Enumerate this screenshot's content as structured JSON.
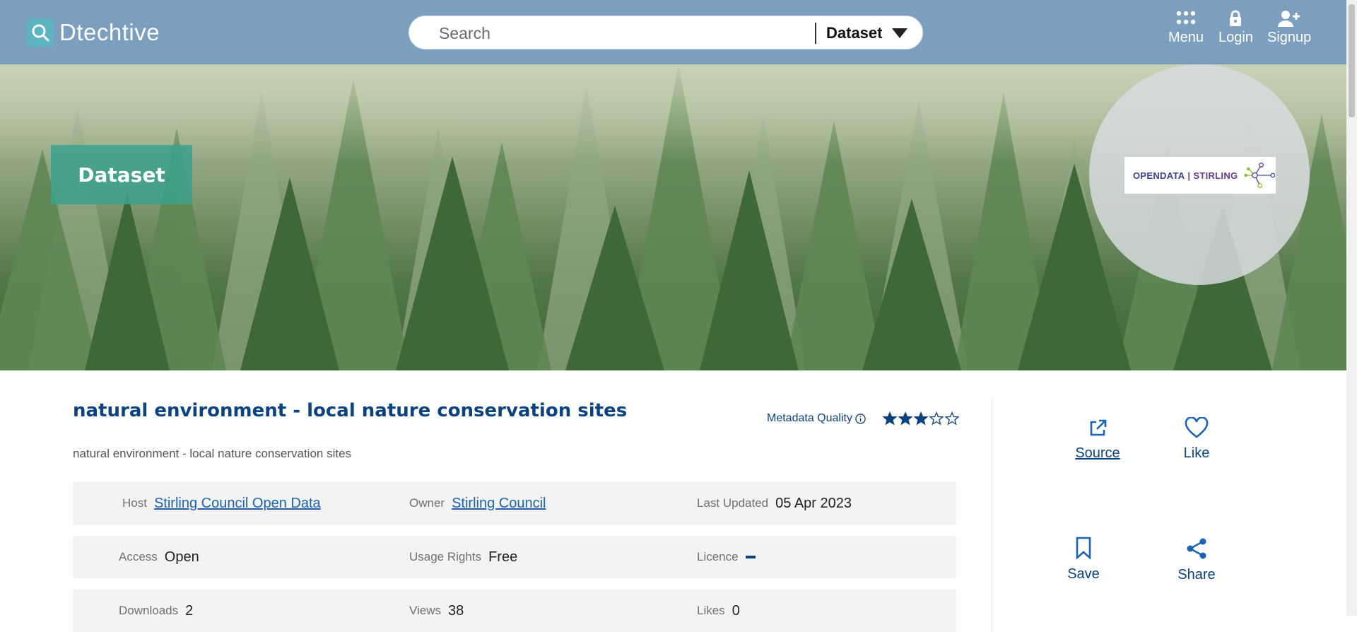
{
  "header": {
    "brand": "Dtechtive",
    "search_placeholder": "Search",
    "search_scope": "Dataset",
    "nav": [
      {
        "label": "Menu",
        "icon": "grid-icon"
      },
      {
        "label": "Login",
        "icon": "lock-icon"
      },
      {
        "label": "Signup",
        "icon": "user-plus-icon"
      }
    ]
  },
  "hero": {
    "badge": "Dataset",
    "organisation_logo": {
      "part1": "OPENDATA",
      "separator": "|",
      "part2": "STIRLING"
    }
  },
  "dataset": {
    "title": "natural environment - local nature conservation sites",
    "description": "natural environment - local nature conservation sites",
    "metadata_quality_label": "Metadata Quality",
    "metadata_quality_rating": 3,
    "metadata_quality_max": 5,
    "rows": [
      [
        {
          "label": "Host",
          "value": "Stirling Council Open Data",
          "link": true
        },
        {
          "label": "Owner",
          "value": "Stirling Council",
          "link": true
        },
        {
          "label": "Last Updated",
          "value": "05 Apr 2023",
          "link": false
        }
      ],
      [
        {
          "label": "Access",
          "value": "Open",
          "link": false
        },
        {
          "label": "Usage Rights",
          "value": "Free",
          "link": false
        },
        {
          "label": "Licence",
          "value": "",
          "link": false
        }
      ],
      [
        {
          "label": "Downloads",
          "value": "2",
          "link": false
        },
        {
          "label": "Views",
          "value": "38",
          "link": false
        },
        {
          "label": "Likes",
          "value": "0",
          "link": false
        }
      ]
    ]
  },
  "actions": {
    "source": "Source",
    "like": "Like",
    "save": "Save",
    "share": "Share"
  },
  "colors": {
    "header_bg": "#7c9ebf",
    "accent_teal": "#3ea08c",
    "title_blue": "#0b4280",
    "link_blue": "#1a63b8"
  }
}
